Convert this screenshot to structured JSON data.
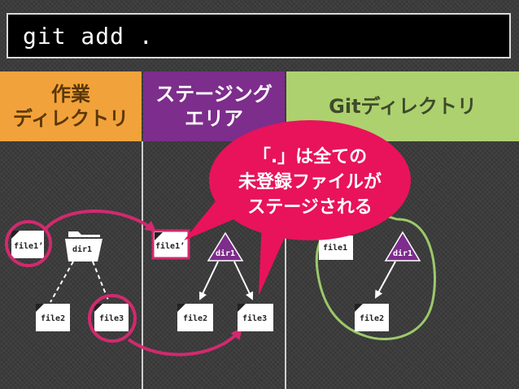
{
  "command": "git add .",
  "headers": {
    "work_line1": "作業",
    "work_line2": "ディレクトリ",
    "stage_line1": "ステージング",
    "stage_line2": "エリア",
    "git": "Gitディレクトリ"
  },
  "callout": {
    "line1": "「.」は全ての",
    "line2": "未登録ファイルが",
    "line3": "ステージされる"
  },
  "work_dir": {
    "file1": "file1’",
    "dir1": "dir1",
    "file2": "file2",
    "file3": "file3"
  },
  "stage_area": {
    "file1": "file1’",
    "dir1": "dir1",
    "file2": "file2",
    "file3": "file3"
  },
  "git_dir": {
    "file1": "file1",
    "dir1": "dir1",
    "file2": "file2"
  },
  "colors": {
    "work": "#f2a23a",
    "stage": "#7d2d8c",
    "git": "#aed16f",
    "highlight": "#d12a6e",
    "callout": "#e8135b"
  }
}
